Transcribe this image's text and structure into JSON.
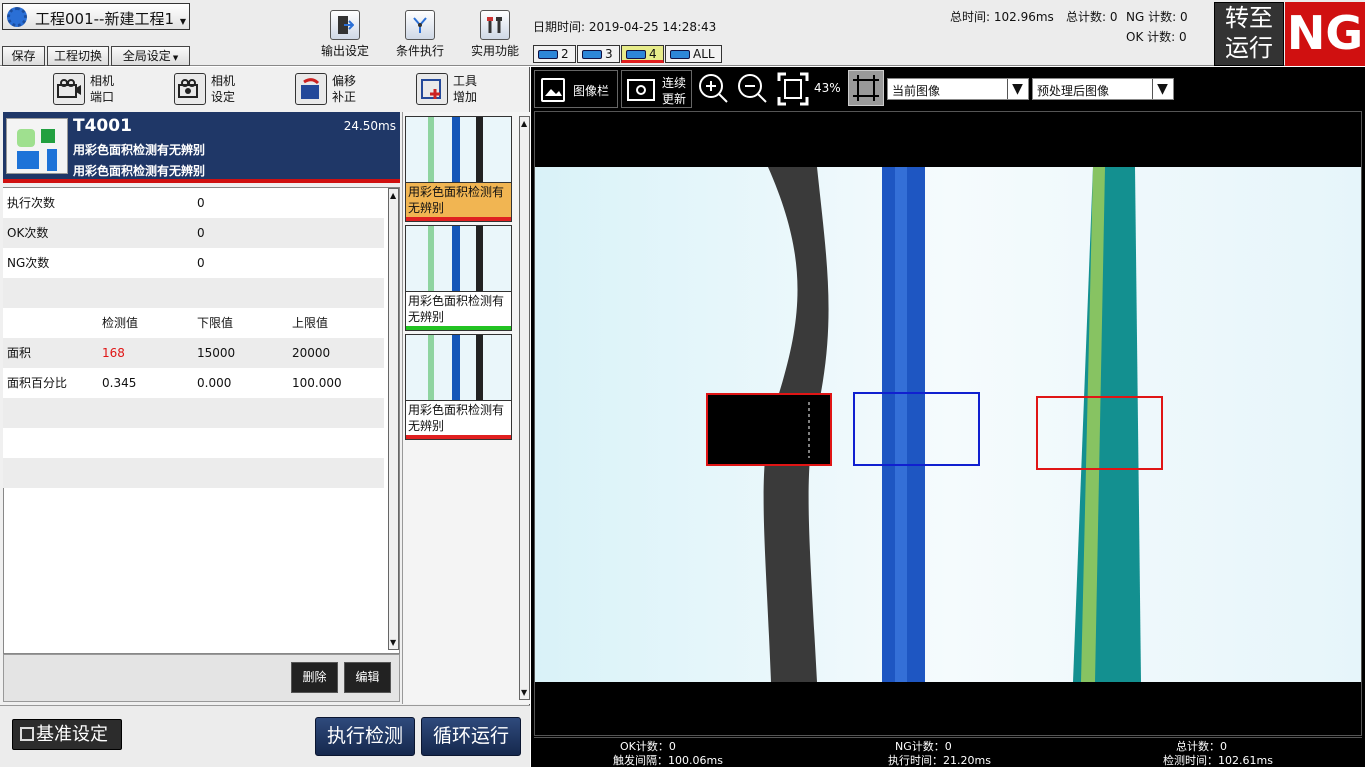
{
  "header": {
    "project_title": "工程001--新建工程1",
    "save": "保存",
    "project_switch": "工程切换",
    "global_settings": "全局设定",
    "output_settings": "输出设定",
    "conditional_exec": "条件执行",
    "utilities": "实用功能",
    "datetime_label": "日期时间: 2019-04-25 14:28:43",
    "total_time": "总时间: 102.96ms",
    "total_count": "总计数: 0",
    "ng_count": "NG 计数: 0",
    "ok_count": "OK 计数: 0",
    "switch_run_line1": "转至",
    "switch_run_line2": "运行",
    "result": "NG",
    "camera_tabs": [
      "2",
      "3",
      "4",
      "ALL"
    ]
  },
  "side_toolbar": [
    {
      "l1": "相机",
      "l2": "端口"
    },
    {
      "l1": "相机",
      "l2": "设定"
    },
    {
      "l1": "偏移",
      "l2": "补正"
    },
    {
      "l1": "工具",
      "l2": "增加"
    }
  ],
  "tool_header": {
    "id": "T4001",
    "time": "24.50ms",
    "line1": "用彩色面积检测有无辨别",
    "line2": "用彩色面积检测有无辨别"
  },
  "stats": {
    "exec_count_label": "执行次数",
    "exec_count": "0",
    "ok_label": "OK次数",
    "ok": "0",
    "ng_label": "NG次数",
    "ng": "0"
  },
  "table": {
    "headers": [
      "检测值",
      "下限值",
      "上限值"
    ],
    "rows": [
      {
        "name": "面积",
        "value": "168",
        "low": "15000",
        "high": "20000"
      },
      {
        "name": "面积百分比",
        "value": "0.345",
        "low": "0.000",
        "high": "100.000"
      }
    ]
  },
  "buttons": {
    "delete": "删除",
    "edit": "编辑",
    "baseline": "基准设定",
    "execute": "执行检测",
    "loop_run": "循环运行"
  },
  "thumbs": [
    {
      "label": "用彩色面积检测有无辨别",
      "status_color": "#e02020"
    },
    {
      "label": "用彩色面积检测有无辨别",
      "status_color": "#22c322"
    },
    {
      "label": "用彩色面积检测有无辨别",
      "status_color": "#e02020"
    }
  ],
  "image_toolbar": {
    "image_bar": "图像栏",
    "continuous_l1": "连续",
    "continuous_l2": "更新",
    "zoom": "43%",
    "current_image": "当前图像",
    "preprocessed": "预处理后图像"
  },
  "footer": {
    "ok_count": "OK计数：0",
    "trigger_interval": "触发间隔：100.06ms",
    "ng_count": "NG计数：0",
    "exec_time": "执行时间：21.20ms",
    "total_count": "总计数：0",
    "detect_time": "检测时间：102.61ms"
  },
  "colors": {
    "header_navy": "#1f3767",
    "ng_red": "#d01010",
    "highlight_orange": "#f1b552",
    "roi_red": "#e01515",
    "roi_blue": "#1020d0"
  }
}
